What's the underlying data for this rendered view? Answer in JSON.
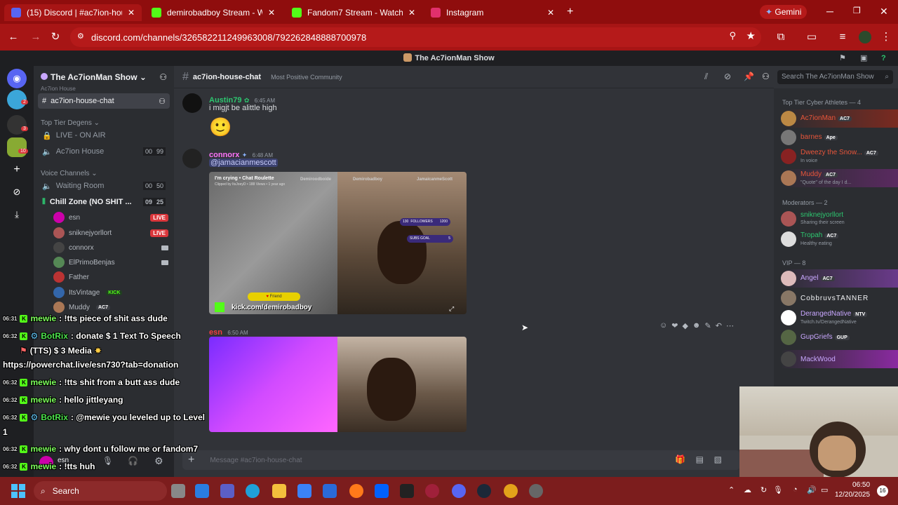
{
  "browser": {
    "tabs": [
      {
        "label": "(15) Discord | #ac7ion-house",
        "fav_color": "#5865f2",
        "active": true
      },
      {
        "label": "demirobadboy Stream - Watch",
        "fav_color": "#53fc18",
        "active": false
      },
      {
        "label": "Fandom7 Stream - Watch Live c",
        "fav_color": "#53fc18",
        "active": false
      },
      {
        "label": "Instagram",
        "fav_color": "#e1306c",
        "active": false
      }
    ],
    "new_tab": "+",
    "gemini_label": "Gemini",
    "url": "discord.com/channels/326582211249963008/792262848888700978"
  },
  "discord": {
    "window_title": "The Ac7ionMan Show",
    "server_name": "The Ac7ionMan Show",
    "server_rail_badges": [
      "2",
      "3",
      "10"
    ],
    "active_channel": "ac7ion-house-chat",
    "channel_list_header": "Ac7ion House",
    "category_top_tier": "Top Tier Degens",
    "channels": [
      {
        "name": "LIVE - ON AIR",
        "type": "locked"
      },
      {
        "name": "Ac7ion House",
        "type": "voice",
        "count_a": "00",
        "count_b": "99"
      }
    ],
    "category_voice": "Voice Channels",
    "voice_channels": [
      {
        "name": "Waiting Room",
        "count_a": "00",
        "count_b": "50"
      },
      {
        "name": "Chill Zone (NO SHIT ...",
        "count_a": "09",
        "count_b": "25"
      }
    ],
    "voice_users": [
      {
        "name": "esn",
        "status": "LIVE",
        "color": "#c0a"
      },
      {
        "name": "sniknejyorllort",
        "status": "LIVE",
        "color": "#a55"
      },
      {
        "name": "connorx",
        "status": "cam",
        "color": "#444"
      },
      {
        "name": "ElPrimoBenjas",
        "status": "cam",
        "color": "#585"
      },
      {
        "name": "Father",
        "status": "",
        "color": "#b33"
      },
      {
        "name": "ItsVintage",
        "status": "",
        "color": "#36a",
        "tag": "KICK"
      },
      {
        "name": "Muddy",
        "status": "",
        "color": "#a75",
        "tag": "AC7"
      }
    ],
    "channel_header": {
      "name": "ac7ion-house-chat",
      "topic": "Most Positive Community",
      "search_placeholder": "Search The Ac7ionMan Show"
    },
    "messages": [
      {
        "author": "Austin79",
        "time": "6:45 AM",
        "text": "i migjt be alittle high",
        "emoji": "🙂",
        "color": "#2dc770"
      },
      {
        "author": "connorx",
        "time": "6:48 AM",
        "mention": "@jamacianmescott",
        "color": "#ff73fa"
      },
      {
        "author": "esn",
        "time": "6:50 AM",
        "color": "#f23f43"
      }
    ],
    "video1": {
      "title": "I'm crying • Chat Roulette",
      "clip_info": "Clipped by ItsJoeyD • 188 Views • 1 year ago",
      "socials": [
        "Demiroodboide",
        "Demirobadboy",
        "JamaicanmeScott"
      ],
      "followers_label": "FOLLOWERS",
      "followers_value": "130",
      "followers_goal": "1200",
      "subs_label": "SUBS GOAL",
      "subs_value": "5",
      "friend_label": "Friend",
      "kick_label": "kick.com/demirobadboy"
    },
    "composer_placeholder": "Message #ac7ion-house-chat",
    "members": {
      "group1": "Top Tier Cyber Athletes — 4",
      "group1_items": [
        {
          "name": "Ac7ionMan",
          "tag": "AC7",
          "color": "#e8553a",
          "sub": ""
        },
        {
          "name": "barnes",
          "tag": "Ape",
          "color": "#e8553a",
          "sub": ""
        },
        {
          "name": "Dweezy the Snow...",
          "tag": "AC7",
          "color": "#e8553a",
          "sub": "In voice"
        },
        {
          "name": "Muddy",
          "tag": "AC7",
          "color": "#e8553a",
          "sub": "\"Quote\" of the day I d..."
        }
      ],
      "group2": "Moderators — 2",
      "group2_items": [
        {
          "name": "sniknejyorllort",
          "tag": "",
          "color": "#2dc770",
          "sub": "Sharing their screen"
        },
        {
          "name": "Tropah",
          "tag": "AC7",
          "color": "#2dc770",
          "sub": "Healthy eating"
        }
      ],
      "group3": "VIP — 8",
      "group3_items": [
        {
          "name": "Angel",
          "tag": "AC7",
          "color": "#c9a7ff",
          "sub": ""
        },
        {
          "name": "CobbruvsTANNER",
          "tag": "",
          "color": "#f2f3f5",
          "sub": ""
        },
        {
          "name": "DerangedNative",
          "tag": "NTV",
          "color": "#c9a7ff",
          "sub": "Twitch.tv/DerangedNative"
        },
        {
          "name": "GupGriefs",
          "tag": "GUP",
          "color": "#c9a7ff",
          "sub": ""
        },
        {
          "name": "MackWood",
          "tag": "",
          "color": "#c9a7ff",
          "sub": ""
        }
      ]
    },
    "user_panel": {
      "name": "esn"
    }
  },
  "overlay_chat": [
    {
      "time": "06:31",
      "name": "mewie",
      "text": ": !tts piece of shit ass dude"
    },
    {
      "time": "06:32",
      "name": "BotRix",
      "text": ": donate  $  1 Text To Speech"
    },
    {
      "time": "",
      "name": "",
      "text": "(TTS)  $  3 Media"
    },
    {
      "time": "",
      "name": "",
      "text": "https://powerchat.live/esn730?tab=donation"
    },
    {
      "time": "06:32",
      "name": "mewie",
      "text": ": !tts shit from a butt ass dude"
    },
    {
      "time": "06:32",
      "name": "mewie",
      "text": ": hello jittleyang"
    },
    {
      "time": "06:32",
      "name": "BotRix",
      "text": ": @mewie you leveled up to Level"
    },
    {
      "time": "",
      "name": "",
      "text": "1"
    },
    {
      "time": "06:32",
      "name": "mewie",
      "text": ": why dont u follow me or fandom7"
    },
    {
      "time": "06:32",
      "name": "mewie",
      "text": ": !tts huh"
    }
  ],
  "taskbar": {
    "search_label": "Search",
    "time": "06:50",
    "date": "12/20/2025",
    "notif_count": "16"
  },
  "colors": {
    "accent": "#5865f2",
    "browser": "#a71515",
    "taskbar": "#7c1d1d",
    "kick": "#53fc18"
  }
}
